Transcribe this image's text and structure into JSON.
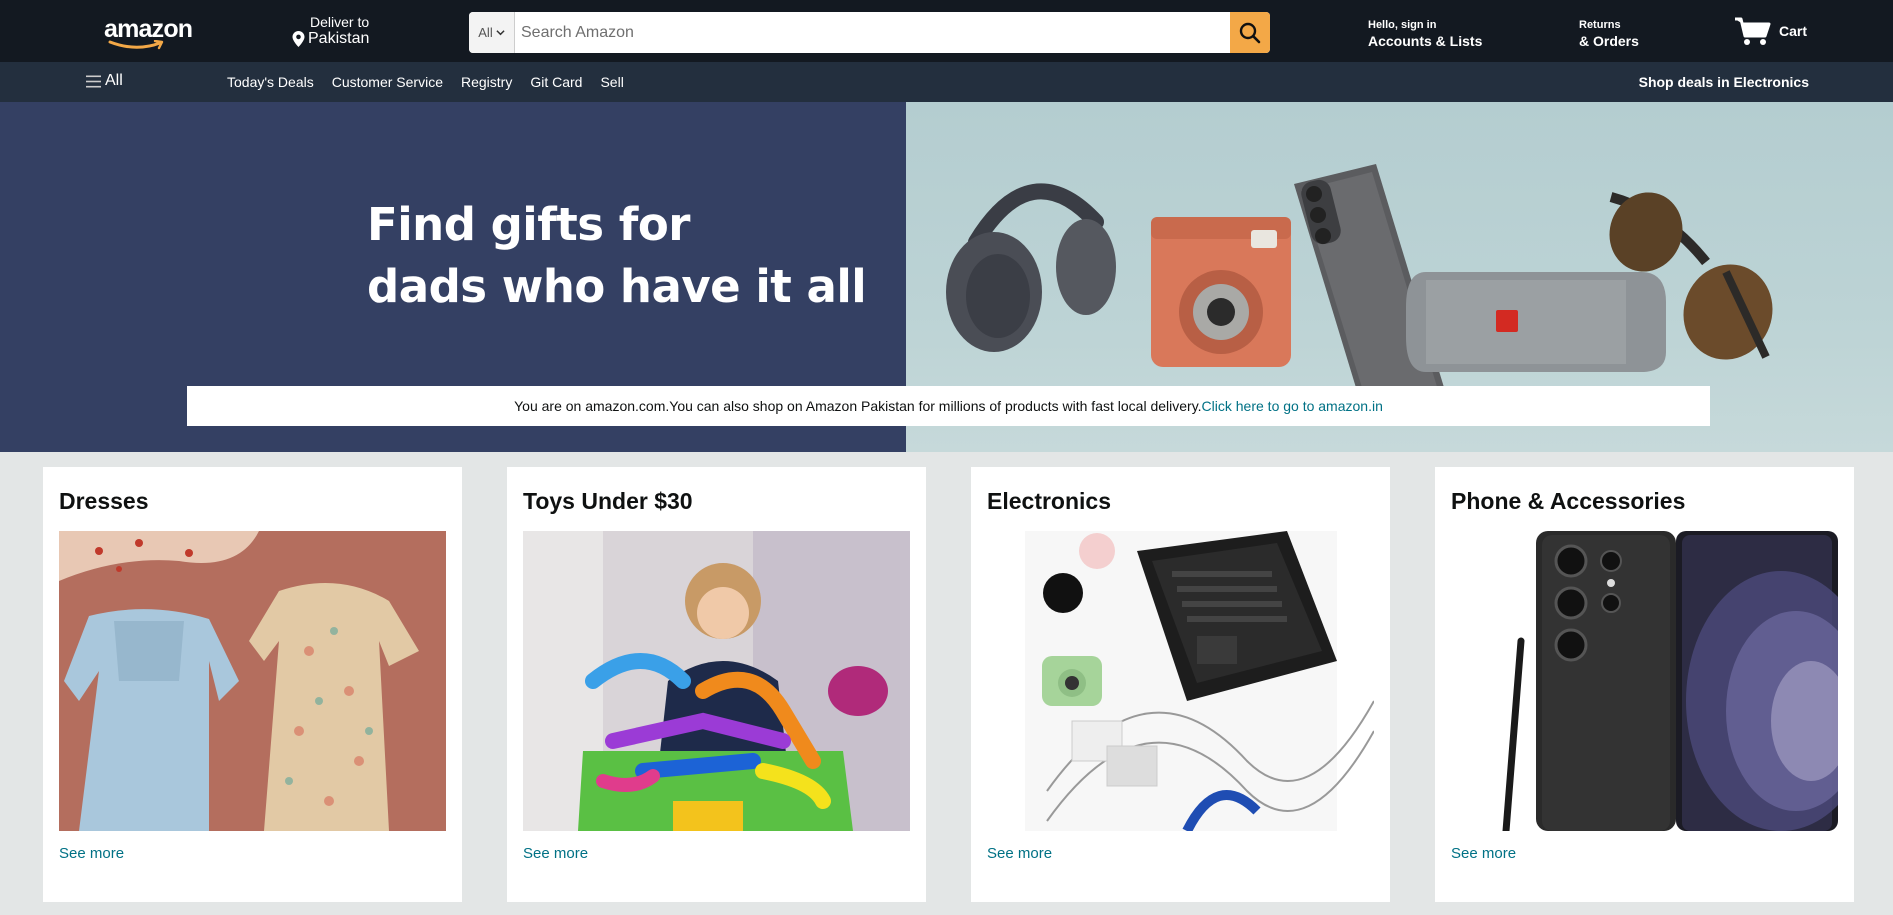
{
  "header": {
    "logo_text": "amazon",
    "deliver_line1": "Deliver to",
    "deliver_line2": "Pakistan",
    "search_category": "All",
    "search_placeholder": "Search Amazon",
    "account_line1": "Hello, sign in",
    "account_line2": "Accounts & Lists",
    "returns_line1": "Returns",
    "returns_line2": "& Orders",
    "cart_label": "Cart",
    "icons": [
      "location-pin-icon",
      "chevron-down-icon",
      "search-icon",
      "cart-icon",
      "hamburger-menu-icon"
    ]
  },
  "subnav": {
    "all_label": "All",
    "links": [
      "Today's Deals",
      "Customer Service",
      "Registry",
      "Git Card",
      "Sell"
    ],
    "deals_label": "Shop deals in Electronics"
  },
  "hero": {
    "title_line1": "Find gifts for",
    "title_line2": "dads who have it all"
  },
  "notice": {
    "text": "You are on amazon.com.You can also shop on Amazon Pakistan for millions of products with fast local delivery.",
    "link": "Click here to go to amazon.in"
  },
  "cards": [
    {
      "title": "Dresses",
      "link": "See more"
    },
    {
      "title": "Toys Under $30",
      "link": "See more"
    },
    {
      "title": "Electronics",
      "link": "See more"
    },
    {
      "title": "Phone & Accessories",
      "link": "See more"
    }
  ],
  "colors": {
    "nav_dark": "#131921",
    "nav_sub": "#232f3e",
    "search_button": "#f3a847",
    "hero_left": "#344063",
    "link": "#007185",
    "page_bg": "#e3e6e6"
  }
}
